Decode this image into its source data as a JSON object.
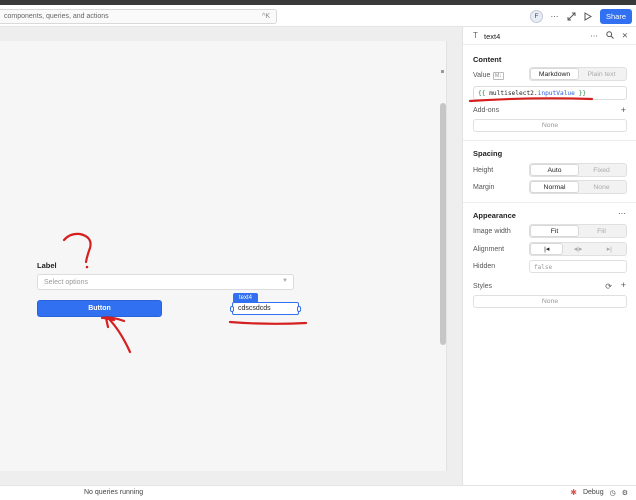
{
  "toolbar": {
    "search_placeholder": "components, queries, and actions",
    "search_shortcut": "^K",
    "avatar_initial": "F",
    "share_label": "Share"
  },
  "canvas": {
    "label_text": "Label",
    "select_placeholder": "Select options",
    "button_label": "Button",
    "text_component_tag": "text4",
    "text_component_value": "cdscsdcds",
    "annotation_mark": "?"
  },
  "panel": {
    "title": "text4",
    "content": {
      "heading": "Content",
      "value_label": "Value",
      "value_badge": "M↓",
      "mode_options": [
        "Markdown",
        "Plain text"
      ],
      "mode_selected": "Markdown",
      "value_expression": {
        "open": "{{",
        "object": "multiselect2.",
        "property": "inputValue",
        "close": "}}"
      },
      "addons_label": "Add-ons",
      "addons_value": "None"
    },
    "spacing": {
      "heading": "Spacing",
      "height_label": "Height",
      "height_options": [
        "Auto",
        "Fixed"
      ],
      "height_selected": "Auto",
      "margin_label": "Margin",
      "margin_options": [
        "Normal",
        "None"
      ],
      "margin_selected": "Normal"
    },
    "appearance": {
      "heading": "Appearance",
      "image_width_label": "Image width",
      "image_width_options": [
        "Fit",
        "Fill"
      ],
      "image_width_selected": "Fit",
      "alignment_label": "Alignment",
      "alignment_icons": [
        "align-left-icon",
        "align-center-icon",
        "align-right-icon"
      ],
      "alignment_selected": "left",
      "hidden_label": "Hidden",
      "hidden_value": "false",
      "styles_label": "Styles",
      "styles_value": "None"
    }
  },
  "statusbar": {
    "queries_text": "No queries running",
    "debug_label": "Debug"
  },
  "colors": {
    "accent": "#3170f0",
    "annotation": "#d62020"
  }
}
